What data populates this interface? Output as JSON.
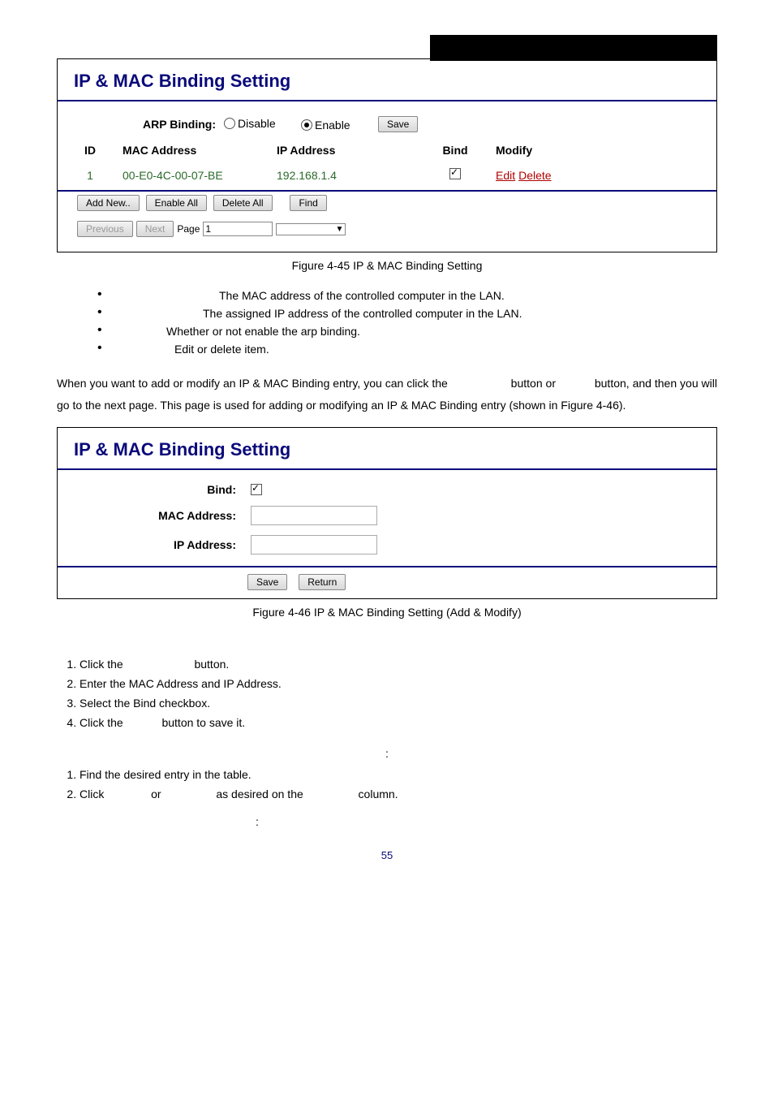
{
  "blackbar": "",
  "fig45": {
    "title": "IP & MAC Binding Setting",
    "arp_label": "ARP Binding:",
    "radio_disable": "Disable",
    "radio_enable": "Enable",
    "save_btn": "Save",
    "hdr_id": "ID",
    "hdr_mac": "MAC Address",
    "hdr_ip": "IP Address",
    "hdr_bind": "Bind",
    "hdr_mod": "Modify",
    "row_id": "1",
    "row_mac": "00-E0-4C-00-07-BE",
    "row_ip": "192.168.1.4",
    "edit": "Edit",
    "delete": "Delete",
    "btn_addnew": "Add New..",
    "btn_enableall": "Enable All",
    "btn_deleteall": "Delete All",
    "btn_find": "Find",
    "btn_prev": "Previous",
    "btn_next": "Next",
    "page_label": "Page",
    "page_value": "1",
    "caption": "Figure 4-45   IP & MAC Binding Setting"
  },
  "bullets": {
    "b1": "The MAC address of the controlled computer in the LAN.",
    "b2": "The assigned IP address of the controlled computer in the LAN.",
    "b3": "Whether or not enable the arp binding.",
    "b4": "Edit or delete item."
  },
  "para1_a": "When you want to add or modify an IP & MAC Binding entry, you can click the ",
  "para1_b": " button or ",
  "para1_c": " button, and then you will go to the next page. This page is used for adding or modifying an IP & MAC Binding entry (shown in Figure 4-46).",
  "fig46": {
    "title": "IP & MAC Binding Setting",
    "bind_label": "Bind:",
    "mac_label": "MAC Address:",
    "ip_label": "IP Address:",
    "btn_save": "Save",
    "btn_return": "Return",
    "caption": "Figure 4-46   IP & MAC Binding Setting (Add & Modify)"
  },
  "steps_a": {
    "s1a": "Click the ",
    "s1b": " button.",
    "s2": "Enter the MAC Address and IP Address.",
    "s3": "Select the Bind checkbox.",
    "s4a": "Click the ",
    "s4b": " button to save it."
  },
  "colon1": ":",
  "steps_b": {
    "s1": "Find the desired entry in the table.",
    "s2a": "Click ",
    "s2b": " or ",
    "s2c": " as desired on the ",
    "s2d": " column."
  },
  "colon2": ":",
  "pagenum": "55"
}
